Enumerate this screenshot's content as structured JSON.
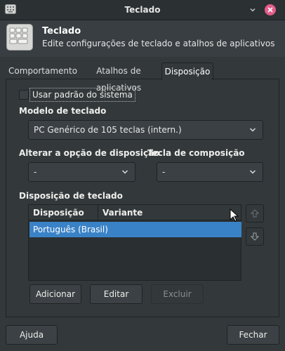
{
  "window": {
    "title": "Teclado"
  },
  "header": {
    "title": "Teclado",
    "subtitle": "Edite configurações de teclado e atalhos de aplicativos"
  },
  "tabs": [
    {
      "label": "Comportamento"
    },
    {
      "label": "Atalhos de aplicativos"
    },
    {
      "label": "Disposição"
    }
  ],
  "layout_tab": {
    "use_system_default": {
      "label": "Usar padrão do sistema",
      "checked": false
    },
    "keyboard_model": {
      "label": "Modelo de teclado",
      "value": "PC Genérico de 105 teclas (intern.)"
    },
    "layout_option": {
      "label": "Alterar a opção de disposição",
      "value": "-"
    },
    "compose_key": {
      "label": "Tecla de composição",
      "value": "-"
    },
    "keyboard_layout": {
      "label": "Disposição de teclado",
      "columns": [
        "Disposição",
        "Variante"
      ],
      "rows": [
        {
          "layout": "Português (Brasil)",
          "variant": ""
        }
      ]
    },
    "buttons": {
      "add": "Adicionar",
      "edit": "Editar",
      "remove": "Excluir"
    }
  },
  "footer": {
    "help": "Ajuda",
    "close": "Fechar"
  },
  "colors": {
    "accent": "#3a82c7",
    "close_button": "#e35d8a",
    "background": "#33393b"
  }
}
